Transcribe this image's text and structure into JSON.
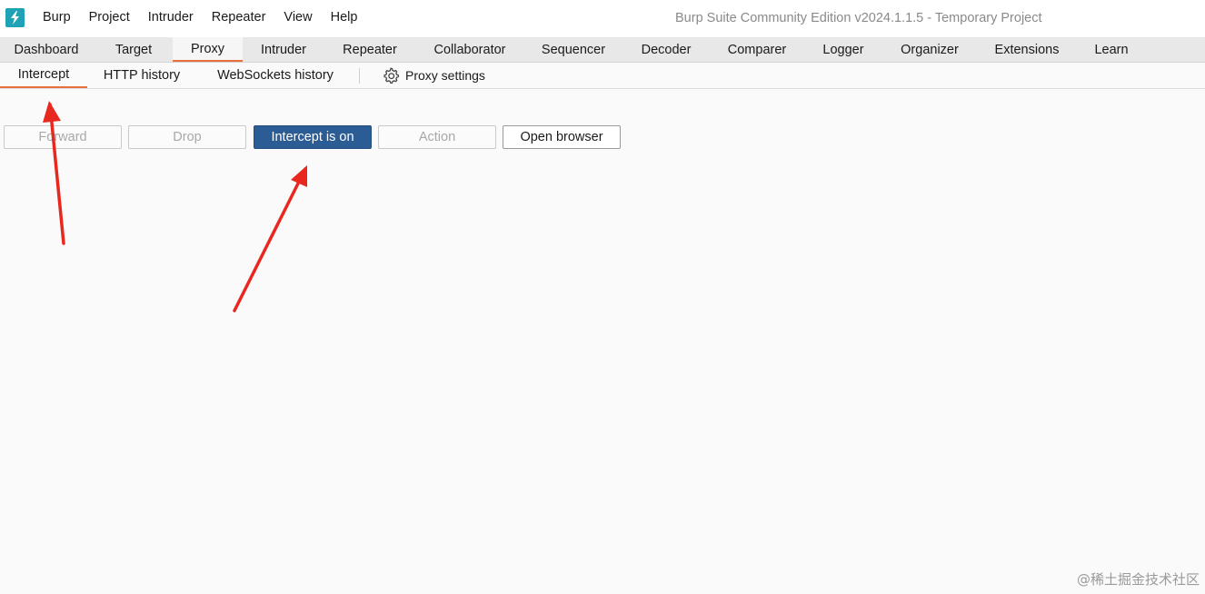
{
  "app": {
    "logo_icon": "burp-lightning-icon",
    "window_title": "Burp Suite Community Edition v2024.1.1.5 - Temporary Project"
  },
  "menu": [
    "Burp",
    "Project",
    "Intruder",
    "Repeater",
    "View",
    "Help"
  ],
  "main_tabs": [
    "Dashboard",
    "Target",
    "Proxy",
    "Intruder",
    "Repeater",
    "Collaborator",
    "Sequencer",
    "Decoder",
    "Comparer",
    "Logger",
    "Organizer",
    "Extensions",
    "Learn"
  ],
  "active_main_tab": "Proxy",
  "sub_tabs": [
    "Intercept",
    "HTTP history",
    "WebSockets history"
  ],
  "active_sub_tab": "Intercept",
  "proxy_settings": {
    "label": "Proxy settings",
    "icon": "gear-icon"
  },
  "toolbar": {
    "forward": "Forward",
    "drop": "Drop",
    "intercept_toggle": "Intercept is on",
    "action": "Action",
    "open_browser": "Open browser"
  },
  "colors": {
    "accent_underline": "#e8703a",
    "primary_button": "#2c5c94",
    "logo_bg": "#1fa2b5",
    "annotation_arrow": "#e8281e"
  },
  "watermark": "@稀土掘金技术社区"
}
